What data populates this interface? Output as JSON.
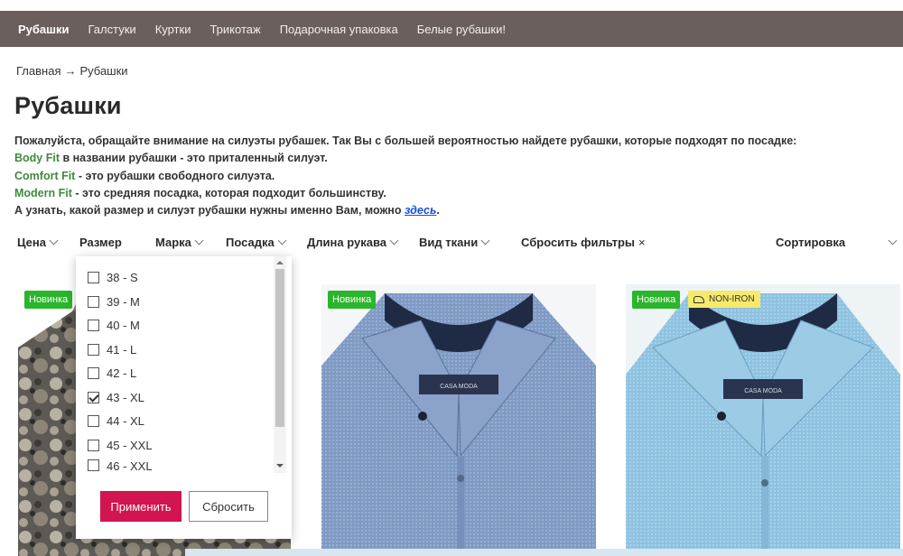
{
  "nav": {
    "items": [
      {
        "label": "Рубашки",
        "active": true
      },
      {
        "label": "Галстуки",
        "active": false
      },
      {
        "label": "Куртки",
        "active": false
      },
      {
        "label": "Трикотаж",
        "active": false
      },
      {
        "label": "Подарочная упаковка",
        "active": false
      },
      {
        "label": "Белые рубашки!",
        "active": false
      }
    ]
  },
  "breadcrumb": {
    "home": "Главная",
    "separator": "→",
    "current": "Рубашки"
  },
  "page_title": "Рубашки",
  "description": {
    "line1": "Пожалуйста, обращайте внимание на силуэты рубашек. Так Вы с большей вероятностью найдете рубашки, которые подходят по посадке:",
    "body_fit": "Body Fit",
    "body_fit_text": " в названии рубашки - это приталенный силуэт.",
    "comfort_fit": "Comfort Fit",
    "comfort_fit_text": " - это рубашки свободного силуэта.",
    "modern_fit": "Modern Fit",
    "modern_fit_text": " - это средняя посадка, которая подходит большинству.",
    "size_text": "А узнать, какой размер и силуэт рубашки нужны именно Вам, можно ",
    "link": "здесь",
    "size_end": "."
  },
  "filters": {
    "price": "Цена",
    "size": "Размер",
    "brand": "Марка",
    "fit": "Посадка",
    "sleeve": "Длина рукава",
    "fabric": "Вид ткани",
    "reset": "Сбросить фильтры",
    "reset_icon": "×",
    "sort": "Сортировка"
  },
  "size_dropdown": {
    "options": [
      {
        "label": "38 - S",
        "checked": false
      },
      {
        "label": "39 - M",
        "checked": false
      },
      {
        "label": "40 - M",
        "checked": false
      },
      {
        "label": "41 - L",
        "checked": false
      },
      {
        "label": "42 - L",
        "checked": false
      },
      {
        "label": "43 - XL",
        "checked": true
      },
      {
        "label": "44 - XL",
        "checked": false
      },
      {
        "label": "45 - XXL",
        "checked": false
      },
      {
        "label": "46 - XXL",
        "checked": false
      }
    ],
    "apply": "Применить",
    "reset": "Сбросить"
  },
  "products": [
    {
      "badge": "Новинка",
      "extra_badge": ""
    },
    {
      "badge": "Новинка",
      "extra_badge": "",
      "label_brand": "CASA MODA"
    },
    {
      "badge": "Новинка",
      "extra_badge": "NON-IRON",
      "label_brand": "CASA MODA"
    }
  ],
  "colors": {
    "nav_bg": "#6b5f5d",
    "fit_green": "#3f8a3c",
    "badge_green": "#2bb52b",
    "apply_red": "#d21450",
    "noniron_yellow": "#f7e96a",
    "link_blue": "#1a4fd8"
  }
}
